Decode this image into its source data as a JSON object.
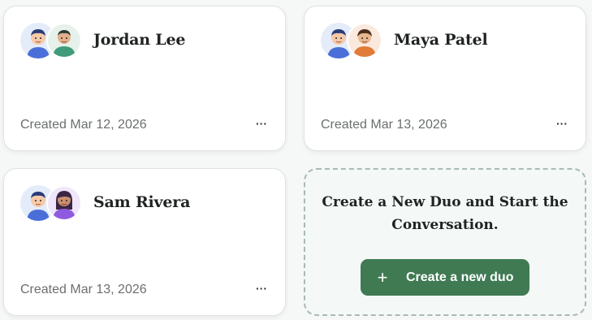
{
  "duos": [
    {
      "name": "Jordan Lee",
      "created": "Created Mar 12, 2026",
      "partner_avatar": "green-shirt-person"
    },
    {
      "name": "Maya Patel",
      "created": "Created Mar 13, 2026",
      "partner_avatar": "orange-shirt-person"
    },
    {
      "name": "Sam Rivera",
      "created": "Created Mar 13, 2026",
      "partner_avatar": "purple-shirt-person"
    }
  ],
  "more_label": "···",
  "new_duo": {
    "title": "Create a New Duo and Start the Conversation.",
    "button_icon": "+",
    "button_label": "Create a new duo"
  },
  "colors": {
    "accent": "#3f7a53",
    "user_shirt": "#4a6fd8",
    "partner_green": "#3f9b7a",
    "partner_orange": "#e07b3a",
    "partner_purple": "#8e5be0"
  }
}
